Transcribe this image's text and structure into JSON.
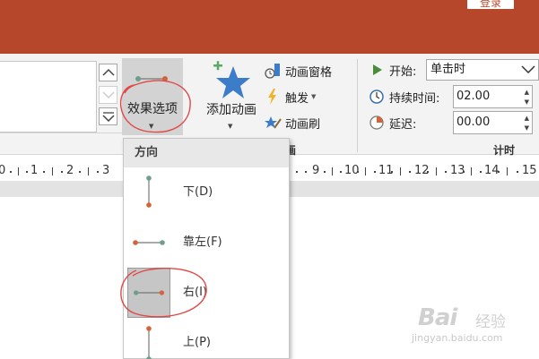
{
  "titlebar": {
    "login_label": "登录",
    "bg_color": "#b7472a"
  },
  "ribbon": {
    "effect_options_label": "效果选项",
    "add_animation_label": "添加动画",
    "animation_pane_label": "动画窗格",
    "trigger_label": "触发",
    "animation_painter_label": "动画刷",
    "animation_group_label": "画",
    "timing_group_label": "计时",
    "timing": {
      "start_label": "开始:",
      "start_value": "单击时",
      "duration_label": "持续时间:",
      "duration_value": "02.00",
      "delay_label": "延迟:",
      "delay_value": "00.00"
    }
  },
  "ruler": {
    "numbers": [
      "0",
      "1",
      "2",
      "3",
      "9",
      "10",
      "11",
      "12",
      "13",
      "14",
      "15"
    ]
  },
  "dropdown": {
    "header": "方向",
    "items": [
      {
        "label": "下(D)",
        "icon": "direction-down-icon",
        "selected": false
      },
      {
        "label": "靠左(F)",
        "icon": "direction-left-icon",
        "selected": false
      },
      {
        "label": "右(I)",
        "icon": "direction-right-icon",
        "selected": true
      },
      {
        "label": "上(P)",
        "icon": "direction-up-icon",
        "selected": false
      }
    ]
  },
  "watermark": {
    "brand": "Bai",
    "brand_cn": "经验",
    "url": "jingyan.baidu.com"
  },
  "colors": {
    "accent_red": "#d9534f",
    "dot_teal": "#6e9e8c",
    "dot_orange": "#d4633a",
    "star_blue": "#3d7cc9"
  }
}
